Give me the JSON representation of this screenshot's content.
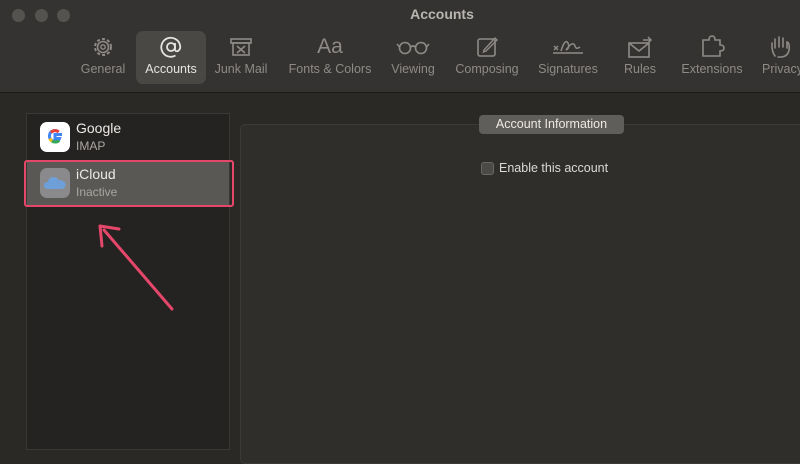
{
  "window": {
    "title": "Accounts"
  },
  "toolbar": {
    "items": [
      {
        "label": "General",
        "icon": "gear-icon"
      },
      {
        "label": "Accounts",
        "icon": "at-sign-icon",
        "active": true
      },
      {
        "label": "Junk Mail",
        "icon": "junk-mail-icon"
      },
      {
        "label": "Fonts & Colors",
        "icon": "font-icon",
        "glyph": "Aa"
      },
      {
        "label": "Viewing",
        "icon": "glasses-icon"
      },
      {
        "label": "Composing",
        "icon": "compose-icon"
      },
      {
        "label": "Signatures",
        "icon": "signature-icon"
      },
      {
        "label": "Rules",
        "icon": "rules-icon"
      },
      {
        "label": "Extensions",
        "icon": "puzzle-icon"
      },
      {
        "label": "Privacy",
        "icon": "hand-icon"
      }
    ]
  },
  "accounts": [
    {
      "name": "Google",
      "type": "IMAP",
      "icon": "google-icon"
    },
    {
      "name": "iCloud",
      "type": "Inactive",
      "icon": "icloud-icon",
      "selected": true
    }
  ],
  "detail": {
    "section_tab": "Account Information",
    "enable_label": "Enable this account",
    "enable_checked": false
  },
  "colors": {
    "highlight": "#e5476b",
    "background": "#2b2926",
    "selected_row": "#5a5855"
  }
}
